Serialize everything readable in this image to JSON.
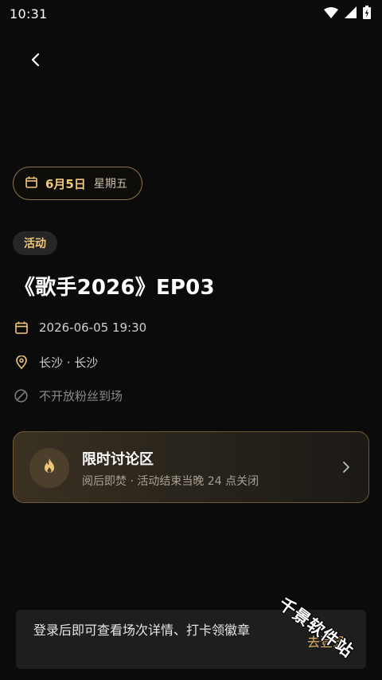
{
  "status_bar": {
    "time": "10:31",
    "icons": [
      "wifi-icon",
      "signal-icon",
      "battery-charging-icon"
    ]
  },
  "nav": {
    "back_icon": "chevron-left-icon"
  },
  "date_pill": {
    "icon": "calendar-icon",
    "date": "6月5日",
    "weekday": "星期五"
  },
  "event": {
    "category": "活动",
    "title": "《歌手2026》EP03",
    "datetime": "2026-06-05 19:30",
    "location": "长沙 · 长沙",
    "fan_policy": "不开放粉丝到场"
  },
  "discussion": {
    "icon": "fire-icon",
    "title": "限时讨论区",
    "subtitle": "阅后即焚 · 活动结束当晚 24 点关闭",
    "chevron": "chevron-right-icon"
  },
  "login_banner": {
    "text": "登录后即可查看场次详情、打卡领徽章",
    "action": "去登录"
  },
  "watermark": "千景软件站",
  "colors": {
    "background": "#0b0b0b",
    "accent_gold": "#f0c77a",
    "card_border": "#6e5a37",
    "login_link": "#e3b466"
  }
}
